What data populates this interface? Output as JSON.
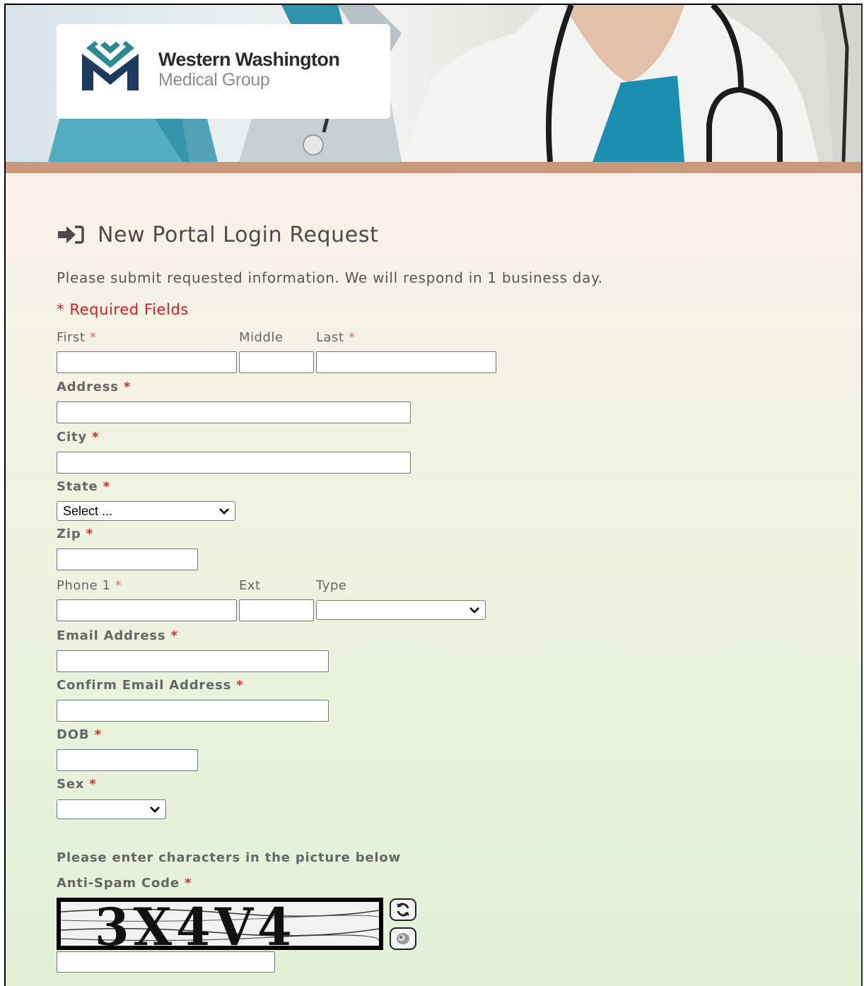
{
  "header": {
    "logo_line1": "Western Washington",
    "logo_line2": "Medical Group"
  },
  "form": {
    "title": "New Portal Login Request",
    "intro": "Please submit requested information. We will respond in 1 business day.",
    "required_note": "* Required Fields",
    "labels": {
      "first": "First",
      "middle": "Middle",
      "last": "Last",
      "address": "Address",
      "city": "City",
      "state": "State",
      "zip": "Zip",
      "phone1": "Phone 1",
      "ext": "Ext",
      "type": "Type",
      "email": "Email Address",
      "confirm_email": "Confirm Email Address",
      "dob": "DOB",
      "sex": "Sex",
      "captcha_prompt": "Please enter characters in the picture below",
      "anti_spam": "Anti-Spam Code"
    },
    "required_star": "*",
    "state_selected": "Select ...",
    "phone_type_selected": "",
    "sex_selected": "",
    "captcha_text": "3X4V4"
  },
  "colors": {
    "required": "#e0292b",
    "band": "#c99a7c",
    "logo_navy": "#1f3a5f",
    "logo_teal": "#2a8a8f"
  },
  "icons": {
    "title_icon": "sign-in-icon",
    "refresh": "refresh-icon",
    "audio": "audio-icon",
    "dropdown": "chevron-down-icon"
  }
}
